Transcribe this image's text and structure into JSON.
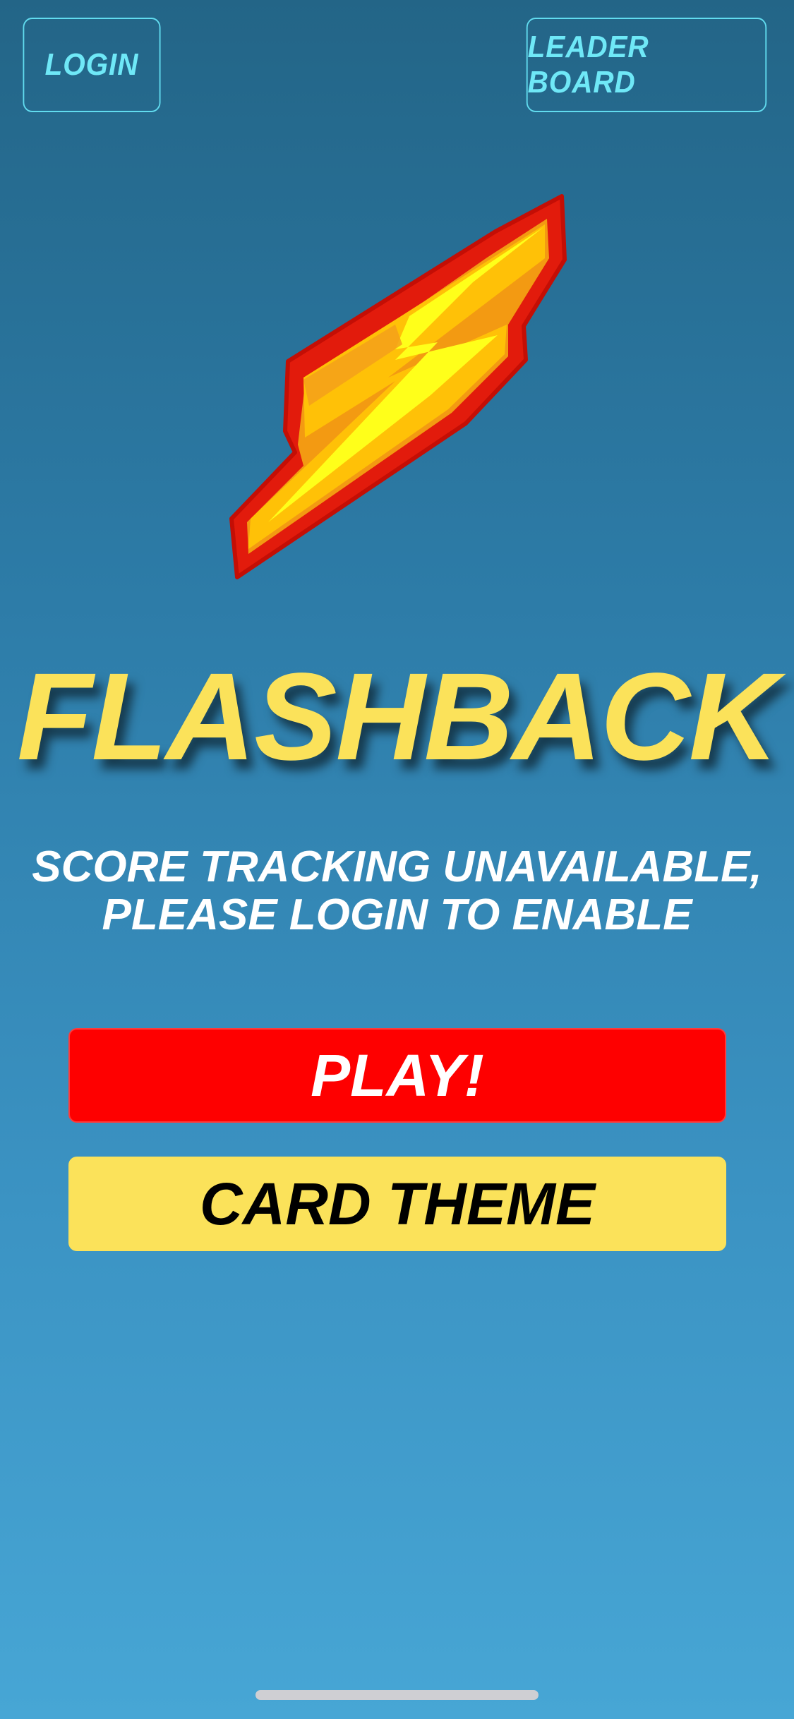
{
  "header": {
    "login_label": "LOGIN",
    "leaderboard_label": "LEADER BOARD"
  },
  "logo": {
    "icon": "lightning-bolt-icon",
    "colors": {
      "outline": "#e21b0c",
      "front": "#ffd400",
      "highlight": "#ffff1a",
      "side": "#f7a315"
    }
  },
  "main": {
    "title": "FLASHBACK",
    "status_line1": "SCORE TRACKING UNAVAILABLE,",
    "status_line2": "PLEASE LOGIN TO ENABLE",
    "play_label": "PLAY!",
    "theme_label": "CARD THEME"
  },
  "colors": {
    "accent_cyan": "#6fe8f7",
    "title_yellow": "#fbe25a",
    "play_red": "#fe0000",
    "theme_yellow": "#fbe25a"
  }
}
